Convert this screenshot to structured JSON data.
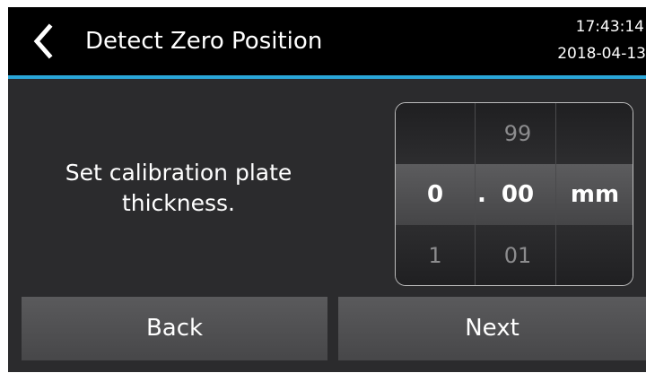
{
  "header": {
    "title": "Detect Zero Position",
    "time": "17:43:14",
    "date": "2018-04-13"
  },
  "main": {
    "prompt_line1": "Set calibration plate",
    "prompt_line2": "thickness."
  },
  "picker": {
    "integer": {
      "above": "",
      "selected": "0",
      "below": "1"
    },
    "separator": ".",
    "decimal": {
      "above": "99",
      "selected": "00",
      "below": "01"
    },
    "unit": "mm"
  },
  "buttons": {
    "back_label": "Back",
    "next_label": "Next"
  },
  "colors": {
    "accent": "#2aa6d8",
    "titlebar": "#000000",
    "background": "#2b2b2d"
  }
}
